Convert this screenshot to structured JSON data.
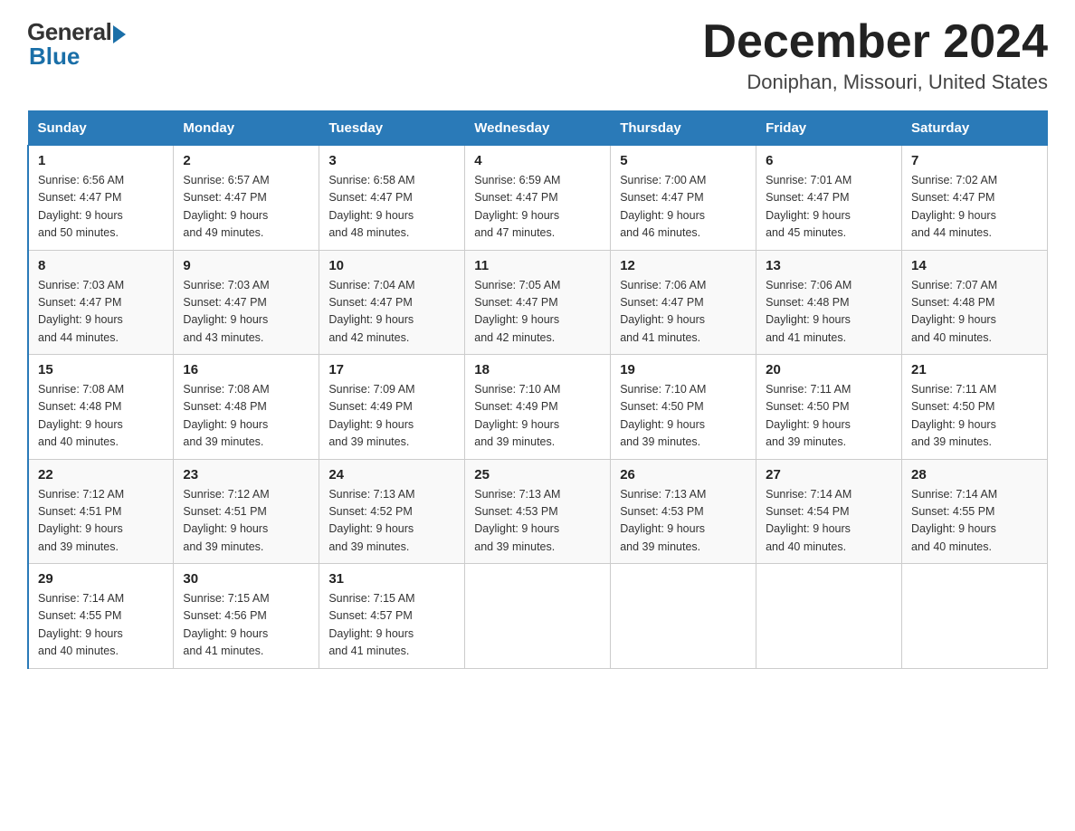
{
  "logo": {
    "general": "General",
    "blue": "Blue"
  },
  "title": "December 2024",
  "location": "Doniphan, Missouri, United States",
  "days_of_week": [
    "Sunday",
    "Monday",
    "Tuesday",
    "Wednesday",
    "Thursday",
    "Friday",
    "Saturday"
  ],
  "weeks": [
    [
      {
        "day": "1",
        "sunrise": "6:56 AM",
        "sunset": "4:47 PM",
        "daylight": "9 hours and 50 minutes."
      },
      {
        "day": "2",
        "sunrise": "6:57 AM",
        "sunset": "4:47 PM",
        "daylight": "9 hours and 49 minutes."
      },
      {
        "day": "3",
        "sunrise": "6:58 AM",
        "sunset": "4:47 PM",
        "daylight": "9 hours and 48 minutes."
      },
      {
        "day": "4",
        "sunrise": "6:59 AM",
        "sunset": "4:47 PM",
        "daylight": "9 hours and 47 minutes."
      },
      {
        "day": "5",
        "sunrise": "7:00 AM",
        "sunset": "4:47 PM",
        "daylight": "9 hours and 46 minutes."
      },
      {
        "day": "6",
        "sunrise": "7:01 AM",
        "sunset": "4:47 PM",
        "daylight": "9 hours and 45 minutes."
      },
      {
        "day": "7",
        "sunrise": "7:02 AM",
        "sunset": "4:47 PM",
        "daylight": "9 hours and 44 minutes."
      }
    ],
    [
      {
        "day": "8",
        "sunrise": "7:03 AM",
        "sunset": "4:47 PM",
        "daylight": "9 hours and 44 minutes."
      },
      {
        "day": "9",
        "sunrise": "7:03 AM",
        "sunset": "4:47 PM",
        "daylight": "9 hours and 43 minutes."
      },
      {
        "day": "10",
        "sunrise": "7:04 AM",
        "sunset": "4:47 PM",
        "daylight": "9 hours and 42 minutes."
      },
      {
        "day": "11",
        "sunrise": "7:05 AM",
        "sunset": "4:47 PM",
        "daylight": "9 hours and 42 minutes."
      },
      {
        "day": "12",
        "sunrise": "7:06 AM",
        "sunset": "4:47 PM",
        "daylight": "9 hours and 41 minutes."
      },
      {
        "day": "13",
        "sunrise": "7:06 AM",
        "sunset": "4:48 PM",
        "daylight": "9 hours and 41 minutes."
      },
      {
        "day": "14",
        "sunrise": "7:07 AM",
        "sunset": "4:48 PM",
        "daylight": "9 hours and 40 minutes."
      }
    ],
    [
      {
        "day": "15",
        "sunrise": "7:08 AM",
        "sunset": "4:48 PM",
        "daylight": "9 hours and 40 minutes."
      },
      {
        "day": "16",
        "sunrise": "7:08 AM",
        "sunset": "4:48 PM",
        "daylight": "9 hours and 39 minutes."
      },
      {
        "day": "17",
        "sunrise": "7:09 AM",
        "sunset": "4:49 PM",
        "daylight": "9 hours and 39 minutes."
      },
      {
        "day": "18",
        "sunrise": "7:10 AM",
        "sunset": "4:49 PM",
        "daylight": "9 hours and 39 minutes."
      },
      {
        "day": "19",
        "sunrise": "7:10 AM",
        "sunset": "4:50 PM",
        "daylight": "9 hours and 39 minutes."
      },
      {
        "day": "20",
        "sunrise": "7:11 AM",
        "sunset": "4:50 PM",
        "daylight": "9 hours and 39 minutes."
      },
      {
        "day": "21",
        "sunrise": "7:11 AM",
        "sunset": "4:50 PM",
        "daylight": "9 hours and 39 minutes."
      }
    ],
    [
      {
        "day": "22",
        "sunrise": "7:12 AM",
        "sunset": "4:51 PM",
        "daylight": "9 hours and 39 minutes."
      },
      {
        "day": "23",
        "sunrise": "7:12 AM",
        "sunset": "4:51 PM",
        "daylight": "9 hours and 39 minutes."
      },
      {
        "day": "24",
        "sunrise": "7:13 AM",
        "sunset": "4:52 PM",
        "daylight": "9 hours and 39 minutes."
      },
      {
        "day": "25",
        "sunrise": "7:13 AM",
        "sunset": "4:53 PM",
        "daylight": "9 hours and 39 minutes."
      },
      {
        "day": "26",
        "sunrise": "7:13 AM",
        "sunset": "4:53 PM",
        "daylight": "9 hours and 39 minutes."
      },
      {
        "day": "27",
        "sunrise": "7:14 AM",
        "sunset": "4:54 PM",
        "daylight": "9 hours and 40 minutes."
      },
      {
        "day": "28",
        "sunrise": "7:14 AM",
        "sunset": "4:55 PM",
        "daylight": "9 hours and 40 minutes."
      }
    ],
    [
      {
        "day": "29",
        "sunrise": "7:14 AM",
        "sunset": "4:55 PM",
        "daylight": "9 hours and 40 minutes."
      },
      {
        "day": "30",
        "sunrise": "7:15 AM",
        "sunset": "4:56 PM",
        "daylight": "9 hours and 41 minutes."
      },
      {
        "day": "31",
        "sunrise": "7:15 AM",
        "sunset": "4:57 PM",
        "daylight": "9 hours and 41 minutes."
      },
      null,
      null,
      null,
      null
    ]
  ],
  "labels": {
    "sunrise": "Sunrise:",
    "sunset": "Sunset:",
    "daylight": "Daylight:"
  }
}
